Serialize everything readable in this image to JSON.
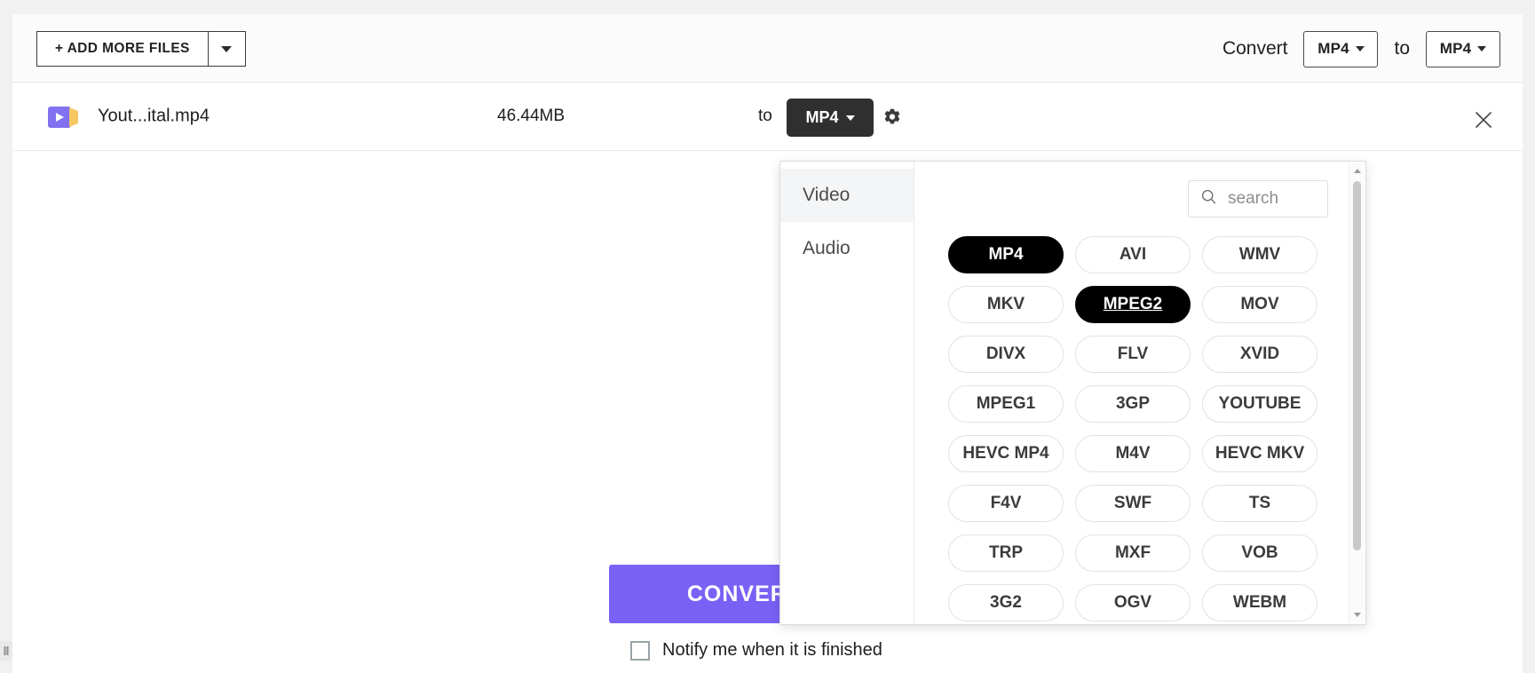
{
  "header": {
    "add_files_label": "+ ADD MORE FILES",
    "add_files_caret_icon": "chevron-down-icon",
    "convert_label": "Convert",
    "source_format": "MP4",
    "to_label": "to",
    "target_format": "MP4"
  },
  "file_row": {
    "thumbnail_icon": "video-file-icon",
    "name": "Yout...ital.mp4",
    "size": "46.44MB",
    "to_label": "to",
    "target_format": "MP4",
    "settings_icon": "gear-icon",
    "remove_icon": "close-icon"
  },
  "main": {
    "convert_button_label": "CONVERT",
    "notify_label": "Notify me when it is finished",
    "notify_checked": false
  },
  "dropdown": {
    "categories": [
      {
        "label": "Video",
        "active": true
      },
      {
        "label": "Audio",
        "active": false
      }
    ],
    "search": {
      "icon": "search-icon",
      "value": "",
      "placeholder": "search"
    },
    "scrollbar": {
      "up_icon": "chevron-up-icon",
      "down_icon": "chevron-down-icon"
    },
    "formats": [
      {
        "label": "MP4",
        "state": "selected"
      },
      {
        "label": "AVI",
        "state": "normal"
      },
      {
        "label": "WMV",
        "state": "normal"
      },
      {
        "label": "MKV",
        "state": "normal"
      },
      {
        "label": "MPEG2",
        "state": "hovered"
      },
      {
        "label": "MOV",
        "state": "normal"
      },
      {
        "label": "DIVX",
        "state": "normal"
      },
      {
        "label": "FLV",
        "state": "normal"
      },
      {
        "label": "XVID",
        "state": "normal"
      },
      {
        "label": "MPEG1",
        "state": "normal"
      },
      {
        "label": "3GP",
        "state": "normal"
      },
      {
        "label": "YOUTUBE",
        "state": "normal"
      },
      {
        "label": "HEVC MP4",
        "state": "normal"
      },
      {
        "label": "M4V",
        "state": "normal"
      },
      {
        "label": "HEVC MKV",
        "state": "normal"
      },
      {
        "label": "F4V",
        "state": "normal"
      },
      {
        "label": "SWF",
        "state": "normal"
      },
      {
        "label": "TS",
        "state": "normal"
      },
      {
        "label": "TRP",
        "state": "normal"
      },
      {
        "label": "MXF",
        "state": "normal"
      },
      {
        "label": "VOB",
        "state": "normal"
      },
      {
        "label": "3G2",
        "state": "normal"
      },
      {
        "label": "OGV",
        "state": "normal"
      },
      {
        "label": "WEBM",
        "state": "normal"
      }
    ]
  },
  "colors": {
    "accent_purple": "#7a61f5",
    "selected_black": "#000000",
    "file_icon_purple": "#8271f0",
    "file_icon_amber": "#f6c863"
  }
}
